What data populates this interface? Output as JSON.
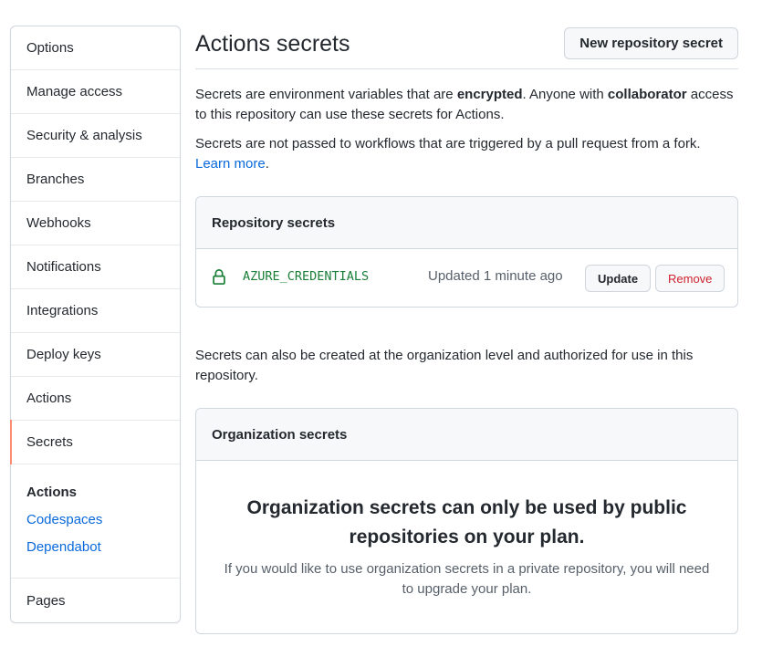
{
  "sidebar": {
    "items": [
      {
        "label": "Options"
      },
      {
        "label": "Manage access"
      },
      {
        "label": "Security & analysis"
      },
      {
        "label": "Branches"
      },
      {
        "label": "Webhooks"
      },
      {
        "label": "Notifications"
      },
      {
        "label": "Integrations"
      },
      {
        "label": "Deploy keys"
      },
      {
        "label": "Actions"
      },
      {
        "label": "Secrets"
      }
    ],
    "active": "Secrets",
    "sub_heading": "Actions",
    "sub_links": [
      "Codespaces",
      "Dependabot"
    ],
    "last_item": "Pages"
  },
  "header": {
    "title": "Actions secrets",
    "new_button": "New repository secret"
  },
  "intro": {
    "p1_a": "Secrets are environment variables that are ",
    "p1_b": "encrypted",
    "p1_c": ". Anyone with ",
    "p1_d": "collaborator",
    "p1_e": " access to this repository can use these secrets for Actions.",
    "p2_a": "Secrets are not passed to workflows that are triggered by a pull request from a fork. ",
    "p2_link": "Learn more",
    "p2_end": "."
  },
  "repo_secrets": {
    "heading": "Repository secrets",
    "rows": [
      {
        "name": "AZURE_CREDENTIALS",
        "updated": "Updated 1 minute ago",
        "update_label": "Update",
        "remove_label": "Remove"
      }
    ]
  },
  "org_note": "Secrets can also be created at the organization level and authorized for use in this repository.",
  "org_secrets": {
    "heading": "Organization secrets",
    "blank_title": "Organization secrets can only be used by public repositories on your plan.",
    "blank_desc": "If you would like to use organization secrets in a private repository, you will need to upgrade your plan."
  },
  "colors": {
    "accent_link": "#0969da",
    "active_indicator": "#fd8c73",
    "secret_name": "#1a7f37",
    "danger": "#cf222e"
  }
}
